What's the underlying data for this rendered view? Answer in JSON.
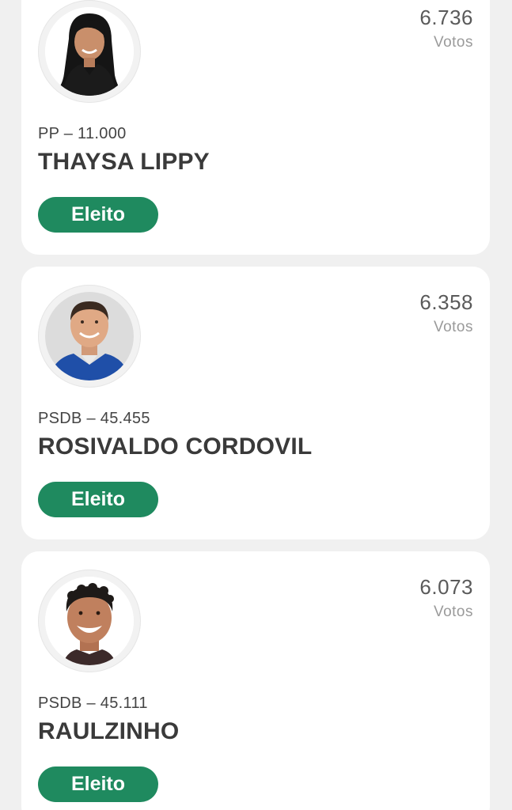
{
  "candidates": [
    {
      "votes": "6.736",
      "votes_label": "Votos",
      "party": "PP – 11.000",
      "name": "THAYSA LIPPY",
      "status": "Eleito"
    },
    {
      "votes": "6.358",
      "votes_label": "Votos",
      "party": "PSDB – 45.455",
      "name": "ROSIVALDO CORDOVIL",
      "status": "Eleito"
    },
    {
      "votes": "6.073",
      "votes_label": "Votos",
      "party": "PSDB – 45.111",
      "name": "RAULZINHO",
      "status": "Eleito"
    }
  ],
  "colors": {
    "elected_badge": "#1f8a5f",
    "card_background": "#ffffff",
    "page_background": "#f0f0f0"
  }
}
